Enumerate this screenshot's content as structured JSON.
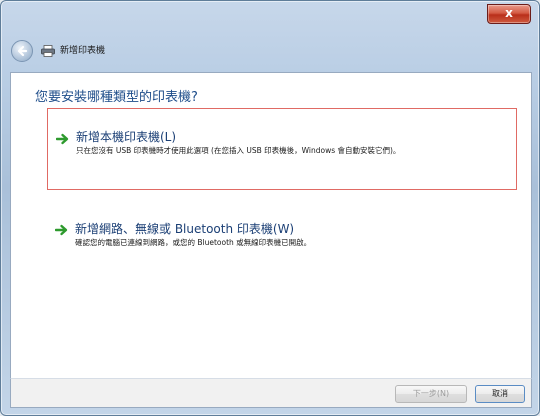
{
  "window": {
    "title": "新增印表機",
    "close_label": "x"
  },
  "main": {
    "question": "您要安裝哪種類型的印表機?",
    "options": [
      {
        "title": "新增本機印表機(L)",
        "description": "只在您沒有 USB 印表機時才使用此選項 (在您插入 USB 印表機後，Windows 會自動安裝它們)。"
      },
      {
        "title": "新增網路、無線或 Bluetooth 印表機(W)",
        "description": "確認您的電腦已連線到網路，或您的 Bluetooth 或無線印表機已開啟。"
      }
    ]
  },
  "footer": {
    "next_label": "下一步(N)",
    "cancel_label": "取消"
  },
  "colors": {
    "accent": "#1e4d8a",
    "selection_border": "#e06a64",
    "arrow_green": "#2e9a2e"
  }
}
